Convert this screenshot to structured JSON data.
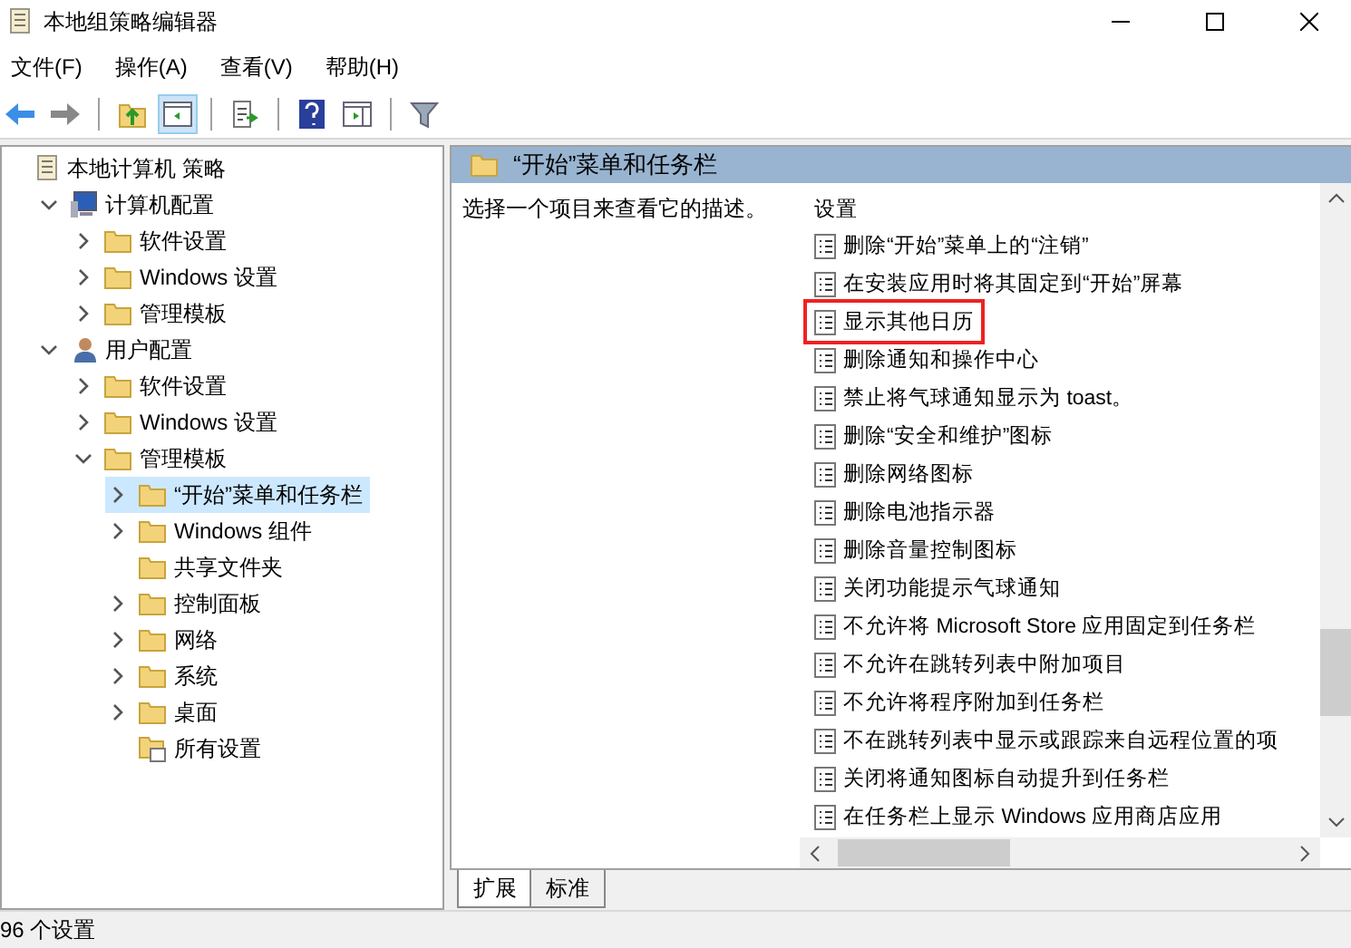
{
  "window": {
    "title": "本地组策略编辑器"
  },
  "menu": [
    "文件(F)",
    "操作(A)",
    "查看(V)",
    "帮助(H)"
  ],
  "toolbar": [
    {
      "kind": "back",
      "pressed": false
    },
    {
      "kind": "forward",
      "pressed": false
    },
    {
      "kind": "separator"
    },
    {
      "kind": "up",
      "pressed": false
    },
    {
      "kind": "tree",
      "pressed": true
    },
    {
      "kind": "separator"
    },
    {
      "kind": "export",
      "pressed": false
    },
    {
      "kind": "separator"
    },
    {
      "kind": "help",
      "pressed": false
    },
    {
      "kind": "pane",
      "pressed": false
    },
    {
      "kind": "separator"
    },
    {
      "kind": "filter",
      "pressed": false
    }
  ],
  "tree": [
    {
      "label": "本地计算机 策略",
      "kind": "root",
      "selected": false,
      "children": [
        {
          "label": "计算机配置",
          "kind": "computer",
          "expanded": true,
          "selected": false,
          "children": [
            {
              "label": "软件设置",
              "kind": "folder",
              "expanded": false,
              "selected": false
            },
            {
              "label": "Windows 设置",
              "kind": "folder",
              "expanded": false,
              "selected": false
            },
            {
              "label": "管理模板",
              "kind": "folder",
              "expanded": false,
              "selected": false
            }
          ]
        },
        {
          "label": "用户配置",
          "kind": "user",
          "expanded": true,
          "selected": false,
          "children": [
            {
              "label": "软件设置",
              "kind": "folder",
              "expanded": false,
              "selected": false
            },
            {
              "label": "Windows 设置",
              "kind": "folder",
              "expanded": false,
              "selected": false
            },
            {
              "label": "管理模板",
              "kind": "folder",
              "expanded": true,
              "selected": false,
              "children": [
                {
                  "label": "“开始”菜单和任务栏",
                  "kind": "folder",
                  "expanded": false,
                  "selected": true
                },
                {
                  "label": "Windows 组件",
                  "kind": "folder",
                  "expanded": false,
                  "selected": false
                },
                {
                  "label": "共享文件夹",
                  "kind": "folder",
                  "selected": false
                },
                {
                  "label": "控制面板",
                  "kind": "folder",
                  "expanded": false,
                  "selected": false
                },
                {
                  "label": "网络",
                  "kind": "folder",
                  "expanded": false,
                  "selected": false
                },
                {
                  "label": "系统",
                  "kind": "folder",
                  "expanded": false,
                  "selected": false
                },
                {
                  "label": "桌面",
                  "kind": "folder",
                  "expanded": false,
                  "selected": false
                },
                {
                  "label": "所有设置",
                  "kind": "all",
                  "selected": false
                }
              ]
            }
          ]
        }
      ]
    }
  ],
  "details": {
    "title": "“开始”菜单和任务栏",
    "description": "选择一个项目来查看它的描述。",
    "column": "设置",
    "settings": [
      {
        "label": "删除“开始”菜单上的“注销”",
        "highlighted": false
      },
      {
        "label": "在安装应用时将其固定到“开始”屏幕",
        "highlighted": false
      },
      {
        "label": "显示其他日历",
        "highlighted": true
      },
      {
        "label": "删除通知和操作中心",
        "highlighted": false
      },
      {
        "label": "禁止将气球通知显示为 toast。",
        "highlighted": false
      },
      {
        "label": "删除“安全和维护”图标",
        "highlighted": false
      },
      {
        "label": "删除网络图标",
        "highlighted": false
      },
      {
        "label": "删除电池指示器",
        "highlighted": false
      },
      {
        "label": "删除音量控制图标",
        "highlighted": false
      },
      {
        "label": "关闭功能提示气球通知",
        "highlighted": false
      },
      {
        "label": "不允许将 Microsoft Store 应用固定到任务栏",
        "highlighted": false
      },
      {
        "label": "不允许在跳转列表中附加项目",
        "highlighted": false
      },
      {
        "label": "不允许将程序附加到任务栏",
        "highlighted": false
      },
      {
        "label": "不在跳转列表中显示或跟踪来自远程位置的项",
        "highlighted": false
      },
      {
        "label": "关闭将通知图标自动提升到任务栏",
        "highlighted": false
      },
      {
        "label": "在任务栏上显示 Windows 应用商店应用",
        "highlighted": false
      }
    ],
    "tabs": [
      {
        "label": "扩展",
        "selected": true
      },
      {
        "label": "标准",
        "selected": false
      }
    ]
  },
  "status_bar": "96 个设置"
}
